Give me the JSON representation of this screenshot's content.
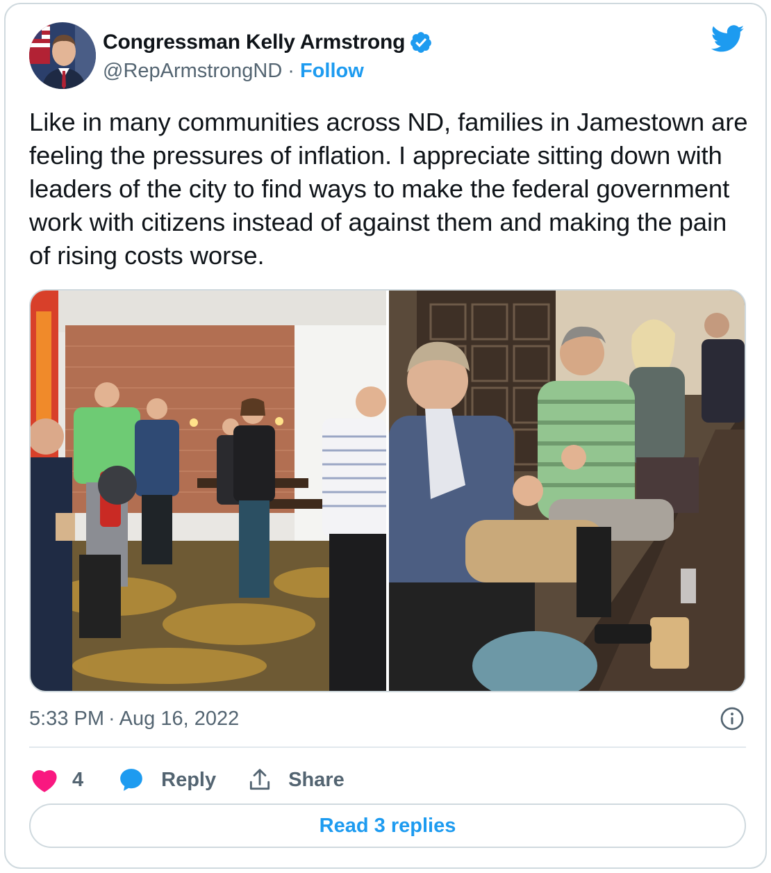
{
  "author": {
    "name": "Congressman Kelly Armstrong",
    "handle": "@RepArmstrongND",
    "separator": "·",
    "follow_label": "Follow"
  },
  "icons": {
    "verified": "verified-badge-icon",
    "brand": "twitter-bird-icon",
    "info": "info-icon",
    "like": "heart-icon",
    "reply": "reply-bubble-icon",
    "share": "share-upload-icon"
  },
  "tweet": {
    "text": "Like in many communities across ND, families in Jamestown are feeling the pressures of inflation. I appreciate sitting down with leaders of the city to find ways to make the federal government work with citizens instead of against them and making the pain of rising costs worse."
  },
  "meta": {
    "time": "5:33 PM",
    "separator": "·",
    "date": "Aug 16, 2022"
  },
  "actions": {
    "like_count": "4",
    "reply_label": "Reply",
    "share_label": "Share"
  },
  "read_replies_label": "Read 3 replies",
  "colors": {
    "brand_blue": "#1d9bf0",
    "like_pink": "#f91880",
    "text": "#0f1419",
    "muted": "#536471",
    "border": "#cfd9de"
  }
}
